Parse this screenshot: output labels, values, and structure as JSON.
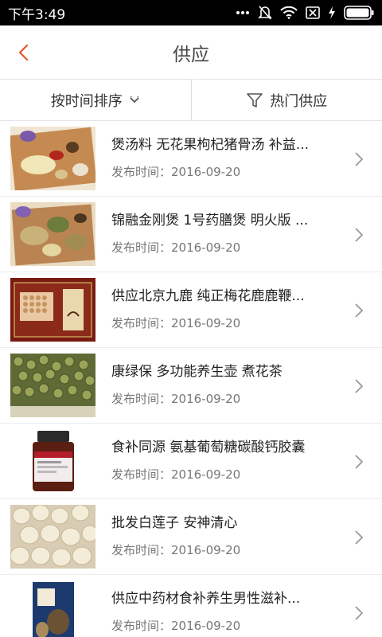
{
  "status": {
    "time": "下午3:49",
    "icons": [
      "more-dots-icon",
      "mute-bell-icon",
      "wifi-icon",
      "no-sim-icon",
      "charging-icon",
      "battery-icon"
    ]
  },
  "header": {
    "title": "供应",
    "back_icon": "chevron-left-icon"
  },
  "colors": {
    "accent": "#e8542b",
    "divider": "#e3e3e3"
  },
  "filters": {
    "sort_label": "按时间排序",
    "sort_icon": "chevron-down-icon",
    "hot_label": "热门供应",
    "hot_icon": "funnel-icon"
  },
  "items": [
    {
      "title": "煲汤料 无花果枸杞猪骨汤 补益...",
      "date": "发布时间：2016-09-20",
      "image": "herbal-soup-ingredients"
    },
    {
      "title": "锦融金刚煲 1号药膳煲 明火版 ...",
      "date": "发布时间：2016-09-20",
      "image": "mixed-herbs"
    },
    {
      "title": "供应北京九鹿 纯正梅花鹿鹿鞭...",
      "date": "发布时间：2016-09-20",
      "image": "deer-slices-box"
    },
    {
      "title": "康绿保 多功能养生壶 煮花茶",
      "date": "发布时间：2016-09-20",
      "image": "green-tea-buds"
    },
    {
      "title": "食补同源 氨基葡萄糖碳酸钙胶囊",
      "date": "发布时间：2016-09-20",
      "image": "supplement-bottle"
    },
    {
      "title": "批发白莲子 安神清心",
      "date": "发布时间：2016-09-20",
      "image": "white-lotus-seeds"
    },
    {
      "title": "供应中药材食补养生男性滋补...",
      "date": "发布时间：2016-09-20",
      "image": "herbal-package"
    }
  ]
}
